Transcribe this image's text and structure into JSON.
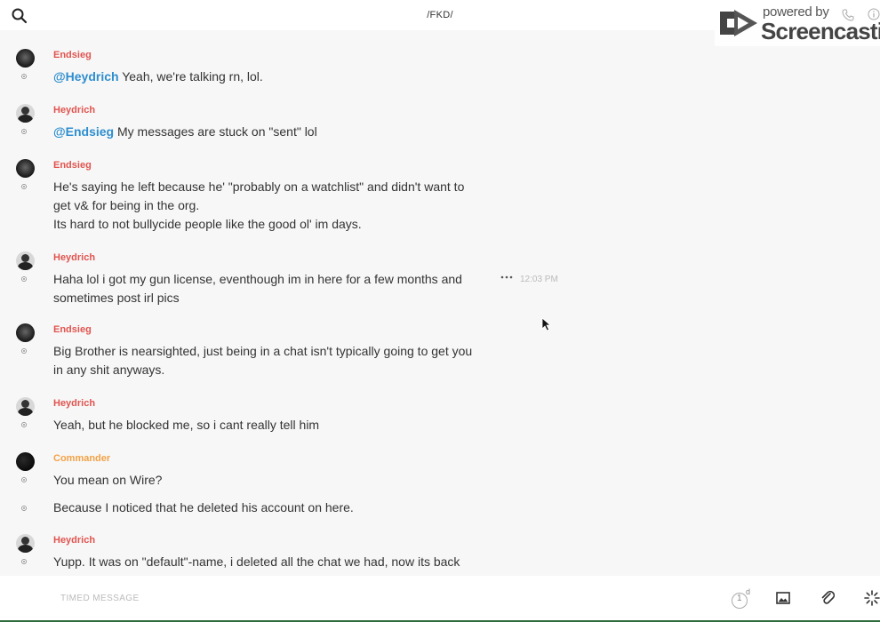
{
  "header": {
    "title": "/FKD/",
    "search_icon": "search-icon"
  },
  "watermark": {
    "line1": "powered by",
    "line2": "Screencastify",
    "call_icon": "phone-icon",
    "info_icon": "info-icon"
  },
  "colors": {
    "sender_red": "#e0544f",
    "sender_orange": "#f2a247",
    "mention": "#2e8ecf"
  },
  "messages": [
    {
      "sender": "Endsieg",
      "lines": [
        {
          "mention": "@Heydrich",
          "text": " Yeah, we're talking rn, lol."
        }
      ]
    },
    {
      "sender": "Heydrich",
      "lines": [
        {
          "mention": "@Endsieg",
          "text": "  My messages are stuck on \"sent\" lol"
        }
      ]
    },
    {
      "sender": "Endsieg",
      "lines": [
        {
          "text": "He's saying he left because he' \"probably on a watchlist\" and didn't want to"
        },
        {
          "text": "get v& for being in the org."
        },
        {
          "text": "Its hard to not bullycide people like the good ol' im days."
        }
      ]
    },
    {
      "sender": "Heydrich",
      "lines": [
        {
          "text": "Haha lol i got my gun license, eventhough im in here for a few months and"
        },
        {
          "text": "sometimes post irl pics"
        }
      ],
      "time": "12:03 PM",
      "actions_icon": "more-dots-icon"
    },
    {
      "sender": "Endsieg",
      "lines": [
        {
          "text": "Big Brother is nearsighted, just being in a chat isn't typically going to get you"
        },
        {
          "text": "in any shit anyways."
        }
      ]
    },
    {
      "sender": "Heydrich",
      "lines": [
        {
          "text": "Yeah, but he blocked me, so i cant really tell him"
        }
      ]
    },
    {
      "sender": "Commander",
      "lines": [
        {
          "text": "You mean on Wire?"
        }
      ]
    },
    {
      "lines": [
        {
          "text": "Because I noticed that he deleted his account on here."
        }
      ]
    },
    {
      "sender": "Heydrich",
      "lines": [
        {
          "text": "Yupp. It was on \"default\"-name, i deleted all the chat we had, now its back"
        }
      ]
    }
  ],
  "composer": {
    "placeholder": "TIMED MESSAGE",
    "timer_count": "1",
    "timer_unit": "d",
    "image_icon": "image-icon",
    "attach_icon": "paperclip-icon",
    "ping_icon": "ping-icon"
  }
}
